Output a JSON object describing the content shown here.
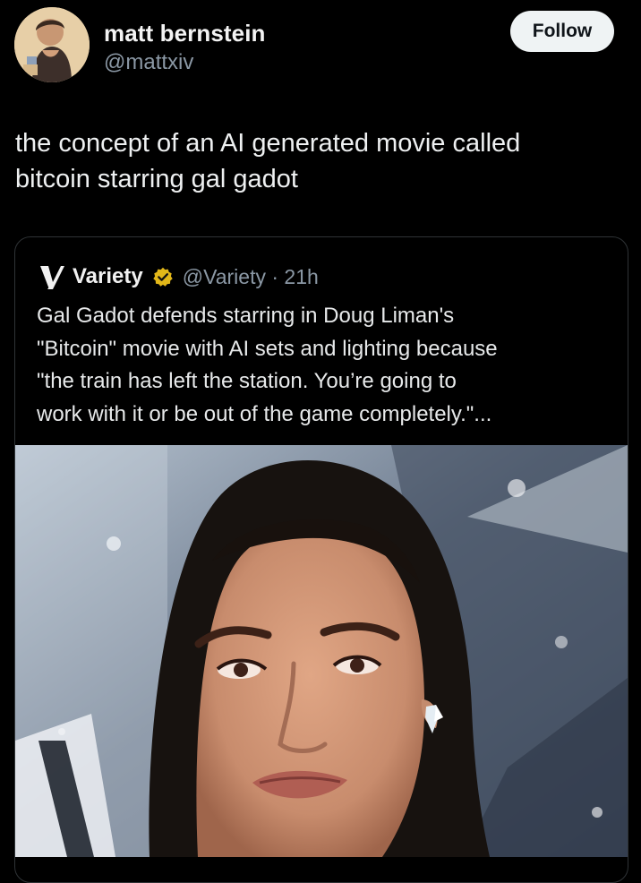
{
  "author": {
    "name": "matt bernstein",
    "handle": "@mattxiv",
    "follow_label": "Follow"
  },
  "post": {
    "text_line1": "the concept of an AI generated movie called",
    "text_line2": "bitcoin starring gal gadot"
  },
  "quoted_post": {
    "account_name": "Variety",
    "handle_time": "@Variety · 21h",
    "text_line1": "Gal Gadot defends starring in Doug Liman's",
    "text_line2": "\"Bitcoin\" movie with AI sets and lighting because",
    "text_line3": "\"the train has left the station. You’re going to",
    "text_line4": "work with it or be out of the game completely.\"..."
  },
  "colors": {
    "background": "#000000",
    "primary_text": "#e7e9ea",
    "secondary_text": "#8b98a5",
    "follow_button": "#eff3f4",
    "verified_gold": "#e2b719",
    "card_border": "#2f3336"
  },
  "icons": {
    "verified": "verified-badge-icon",
    "variety_logo": "variety-logo-icon"
  }
}
